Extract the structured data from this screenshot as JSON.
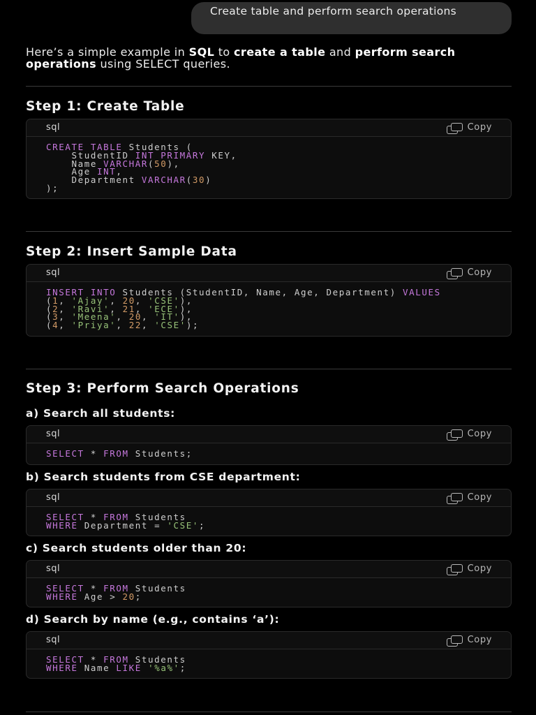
{
  "user_message": "Create table and perform search operations",
  "intro": {
    "p1": "Here’s a simple example in ",
    "b1": "SQL",
    "p2": " to ",
    "b2": "create a table",
    "p3": " and ",
    "b3": "perform search operations",
    "p4": " using SELECT queries."
  },
  "steps": {
    "step1": "Step 1: Create Table",
    "step2": "Step 2: Insert Sample Data",
    "step3": "Step 3: Perform Search Operations"
  },
  "subheadings": {
    "a": "a) Search all students:",
    "b": "b) Search students from CSE department:",
    "c": "c) Search students older than 20:",
    "d": "d) Search by name (e.g., contains ‘a’):"
  },
  "code": {
    "lang": "sql",
    "copy_label": "Copy"
  },
  "colors": {
    "background": "#000000",
    "bubble": "#2f2f2f",
    "keyword": "#c678dd",
    "number": "#d19a66",
    "string": "#98c379"
  }
}
